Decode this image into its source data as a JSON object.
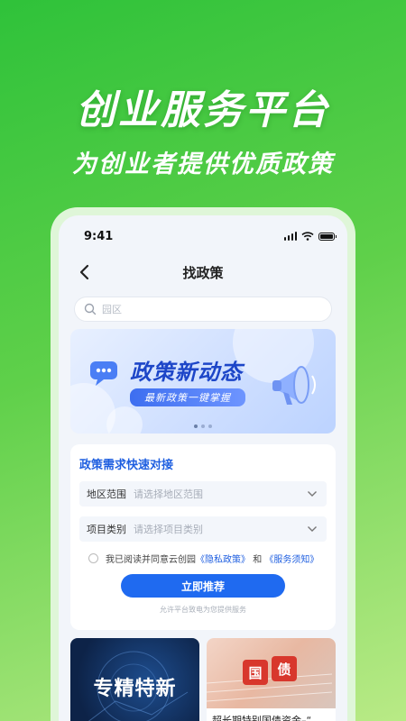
{
  "hero": {
    "title": "创业服务平台",
    "subtitle": "为创业者提供优质政策"
  },
  "status_bar": {
    "time": "9:41"
  },
  "nav": {
    "title": "找政策"
  },
  "search": {
    "placeholder": "园区"
  },
  "banner": {
    "title": "政策新动态",
    "subtitle": "最新政策一键掌握",
    "page_count": 3,
    "active_page": 1
  },
  "form": {
    "title": "政策需求快速对接",
    "fields": [
      {
        "label": "地区范围",
        "placeholder": "请选择地区范围"
      },
      {
        "label": "项目类别",
        "placeholder": "请选择项目类别"
      }
    ],
    "agreement": {
      "prefix": "我已阅读并同意云创园",
      "privacy": "《隐私政策》",
      "and": "和",
      "service": "《服务须知》"
    },
    "submit_label": "立即推荐",
    "footnote": "允许平台致电为您提供服务"
  },
  "tiles": [
    {
      "text": "专精特新"
    },
    {
      "seal_1": "国",
      "seal_2": "债",
      "caption": "超长期特别国债资金–“"
    }
  ],
  "colors": {
    "brand_green": "#2fc23a",
    "accent_blue": "#1f6af0",
    "seal_red": "#d8372c"
  }
}
